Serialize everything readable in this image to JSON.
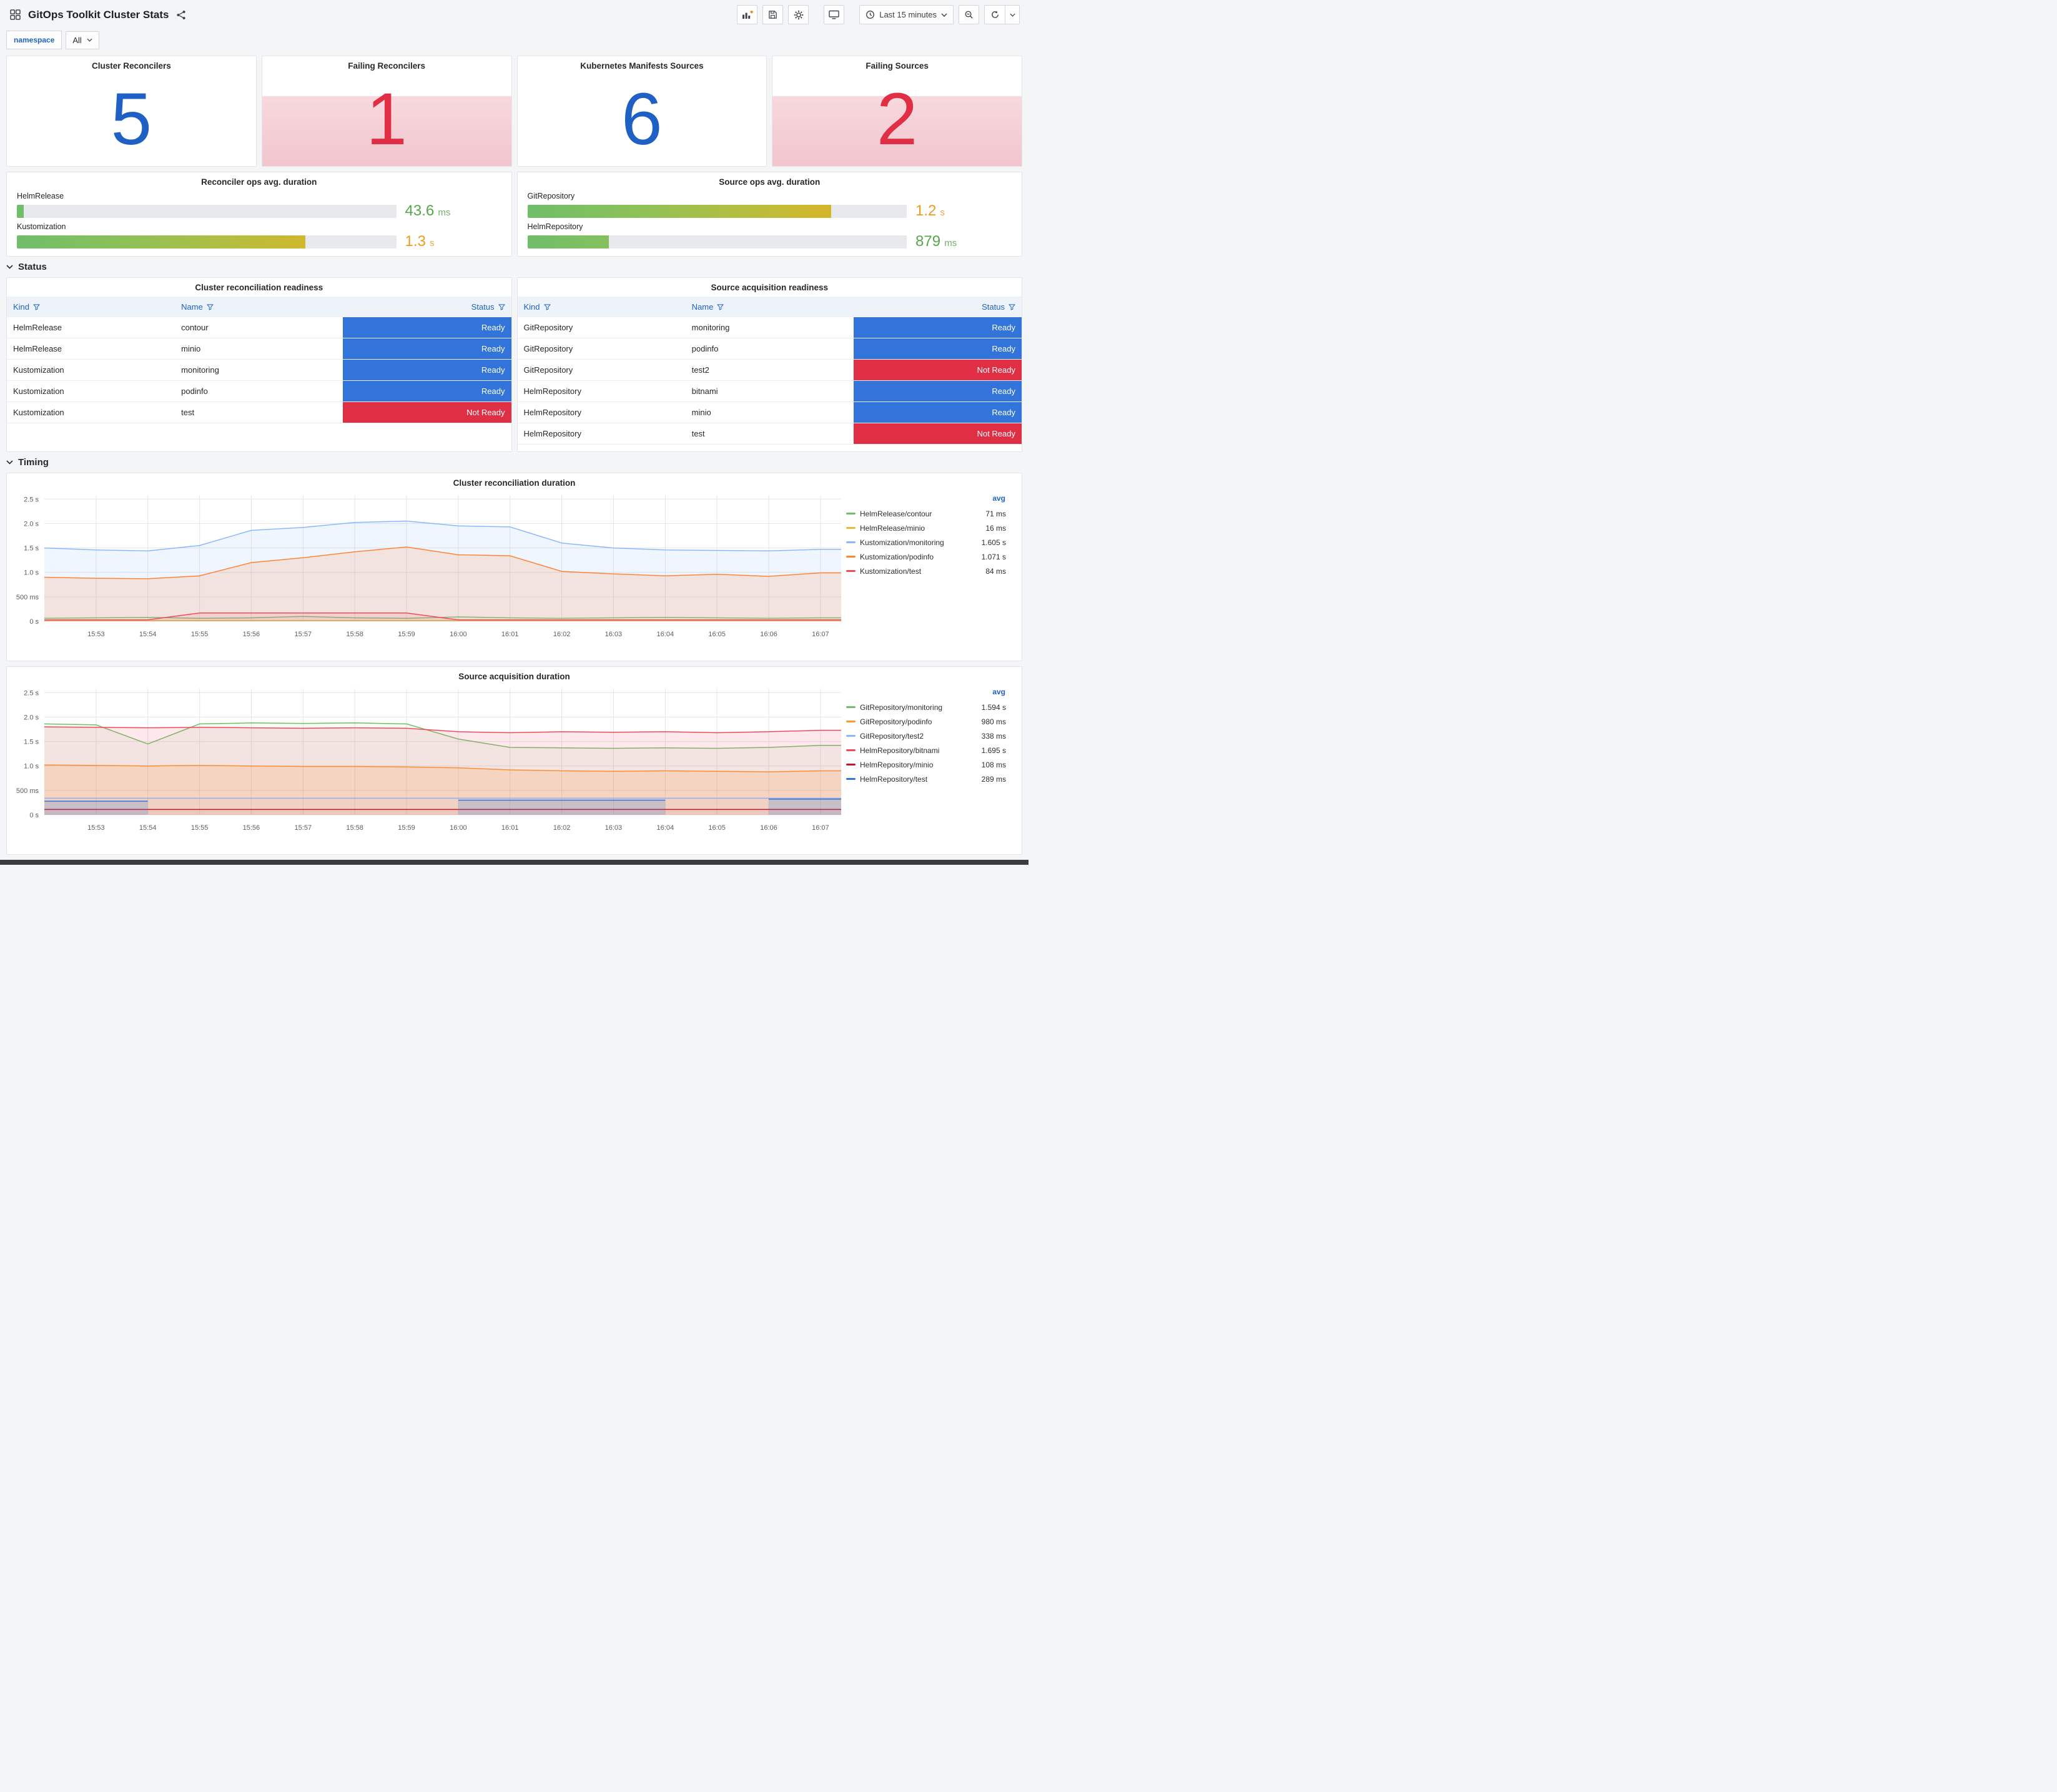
{
  "header": {
    "title": "GitOps Toolkit Cluster Stats",
    "time_picker": "Last 15 minutes"
  },
  "variables": {
    "label": "namespace",
    "value": "All"
  },
  "colors": {
    "ok": "#1f60c4",
    "alert": "#e02f44",
    "ready": "#3274d9",
    "not_ready": "#e02f44",
    "accent": "#1f62c4"
  },
  "icons": [
    "apps-grid-icon",
    "share-icon",
    "panel-add-icon",
    "save-icon",
    "gear-icon",
    "tv-icon",
    "clock-icon",
    "zoom-out-icon",
    "refresh-icon",
    "caret-down-icon",
    "chevron-down-icon",
    "filter-icon"
  ],
  "stats": [
    {
      "title": "Cluster Reconcilers",
      "value": "5",
      "state": "ok"
    },
    {
      "title": "Failing Reconcilers",
      "value": "1",
      "state": "alert"
    },
    {
      "title": "Kubernetes Manifests Sources",
      "value": "6",
      "state": "ok"
    },
    {
      "title": "Failing Sources",
      "value": "2",
      "state": "alert"
    }
  ],
  "gauges": [
    {
      "title": "Reconciler ops avg. duration",
      "bars": [
        {
          "label": "HelmRelease",
          "value": "43.6",
          "unit": "ms",
          "percent": 1.8,
          "value_color": "#56a64b"
        },
        {
          "label": "Kustomization",
          "value": "1.3",
          "unit": "s",
          "percent": 76,
          "value_color": "#ef9b20"
        }
      ]
    },
    {
      "title": "Source ops avg. duration",
      "bars": [
        {
          "label": "GitRepository",
          "value": "1.2",
          "unit": "s",
          "percent": 80,
          "value_color": "#ef9b20"
        },
        {
          "label": "HelmRepository",
          "value": "879",
          "unit": "ms",
          "percent": 21.5,
          "value_color": "#56a64b"
        }
      ]
    }
  ],
  "sections": {
    "status": "Status",
    "timing": "Timing"
  },
  "status_tables": [
    {
      "title": "Cluster reconciliation readiness",
      "columns": [
        "Kind",
        "Name",
        "Status"
      ],
      "rows": [
        {
          "kind": "HelmRelease",
          "name": "contour",
          "status": "Ready"
        },
        {
          "kind": "HelmRelease",
          "name": "minio",
          "status": "Ready"
        },
        {
          "kind": "Kustomization",
          "name": "monitoring",
          "status": "Ready"
        },
        {
          "kind": "Kustomization",
          "name": "podinfo",
          "status": "Ready"
        },
        {
          "kind": "Kustomization",
          "name": "test",
          "status": "Not Ready"
        }
      ]
    },
    {
      "title": "Source acquisition readiness",
      "columns": [
        "Kind",
        "Name",
        "Status"
      ],
      "rows": [
        {
          "kind": "GitRepository",
          "name": "monitoring",
          "status": "Ready"
        },
        {
          "kind": "GitRepository",
          "name": "podinfo",
          "status": "Ready"
        },
        {
          "kind": "GitRepository",
          "name": "test2",
          "status": "Not Ready"
        },
        {
          "kind": "HelmRepository",
          "name": "bitnami",
          "status": "Ready"
        },
        {
          "kind": "HelmRepository",
          "name": "minio",
          "status": "Ready"
        },
        {
          "kind": "HelmRepository",
          "name": "test",
          "status": "Not Ready"
        }
      ]
    }
  ],
  "chart_data": [
    {
      "type": "line",
      "title": "Cluster reconciliation duration",
      "legend_value_header": "avg",
      "legend_position": "right",
      "grid": true,
      "xlim": [
        0,
        15.4
      ],
      "ylim": [
        0,
        2.58
      ],
      "y_ticks": [
        0,
        0.5,
        1.0,
        1.5,
        2.0,
        2.5
      ],
      "y_tick_labels": [
        "0 s",
        "500 ms",
        "1.0 s",
        "1.5 s",
        "2.0 s",
        "2.5 s"
      ],
      "x_ticks": [
        1,
        2,
        3,
        4,
        5,
        6,
        7,
        8,
        9,
        10,
        11,
        12,
        13,
        14,
        15
      ],
      "x_tick_labels": [
        "15:53",
        "15:54",
        "15:55",
        "15:56",
        "15:57",
        "15:58",
        "15:59",
        "16:00",
        "16:01",
        "16:02",
        "16:03",
        "16:04",
        "16:05",
        "16:06",
        "16:07"
      ],
      "x": [
        0,
        1,
        2,
        3,
        4,
        5,
        6,
        7,
        8,
        9,
        10,
        11,
        12,
        13,
        14,
        15,
        15.4
      ],
      "series": [
        {
          "name": "HelmRelease/contour",
          "avg": "71 ms",
          "color": "#73bf69",
          "fill": 0.08,
          "values": [
            0.06,
            0.07,
            0.08,
            0.06,
            0.07,
            0.1,
            0.07,
            0.06,
            0.09,
            0.07,
            0.06,
            0.07,
            0.08,
            0.07,
            0.06,
            0.07,
            0.07
          ]
        },
        {
          "name": "HelmRelease/minio",
          "avg": "16 ms",
          "color": "#eab839",
          "fill": 0.06,
          "values": [
            0.016,
            0.016,
            0.016,
            0.016,
            0.016,
            0.016,
            0.016,
            0.016,
            0.016,
            0.016,
            0.016,
            0.016,
            0.016,
            0.016,
            0.016,
            0.016,
            0.016
          ]
        },
        {
          "name": "Kustomization/monitoring",
          "avg": "1.605 s",
          "color": "#8ab8ff",
          "fill": 0.13,
          "values": [
            1.5,
            1.46,
            1.44,
            1.55,
            1.86,
            1.92,
            2.02,
            2.05,
            1.95,
            1.93,
            1.6,
            1.5,
            1.46,
            1.45,
            1.44,
            1.47,
            1.47
          ]
        },
        {
          "name": "Kustomization/podinfo",
          "avg": "1.071 s",
          "color": "#ff8438",
          "fill": 0.16,
          "values": [
            0.9,
            0.88,
            0.87,
            0.93,
            1.2,
            1.3,
            1.42,
            1.52,
            1.36,
            1.34,
            1.02,
            0.97,
            0.93,
            0.96,
            0.92,
            0.99,
            0.99
          ]
        },
        {
          "name": "Kustomization/test",
          "avg": "84 ms",
          "color": "#f2495c",
          "fill": 0.1,
          "values": [
            0.03,
            0.03,
            0.03,
            0.17,
            0.17,
            0.17,
            0.17,
            0.17,
            0.03,
            0.03,
            0.03,
            0.03,
            0.03,
            0.03,
            0.03,
            0.03,
            0.03
          ]
        }
      ]
    },
    {
      "type": "line",
      "title": "Source acquisition duration",
      "legend_value_header": "avg",
      "legend_position": "right",
      "grid": true,
      "xlim": [
        0,
        15.4
      ],
      "ylim": [
        0,
        2.58
      ],
      "y_ticks": [
        0,
        0.5,
        1.0,
        1.5,
        2.0,
        2.5
      ],
      "y_tick_labels": [
        "0 s",
        "500 ms",
        "1.0 s",
        "1.5 s",
        "2.0 s",
        "2.5 s"
      ],
      "x_ticks": [
        1,
        2,
        3,
        4,
        5,
        6,
        7,
        8,
        9,
        10,
        11,
        12,
        13,
        14,
        15
      ],
      "x_tick_labels": [
        "15:53",
        "15:54",
        "15:55",
        "15:56",
        "15:57",
        "15:58",
        "15:59",
        "16:00",
        "16:01",
        "16:02",
        "16:03",
        "16:04",
        "16:05",
        "16:06",
        "16:07"
      ],
      "x": [
        0,
        1,
        2,
        3,
        4,
        5,
        6,
        7,
        8,
        9,
        10,
        11,
        12,
        13,
        14,
        15,
        15.4
      ],
      "series": [
        {
          "name": "GitRepository/monitoring",
          "avg": "1.594 s",
          "color": "#73bf69",
          "fill": 0.07,
          "values": [
            1.86,
            1.84,
            1.45,
            1.86,
            1.88,
            1.87,
            1.88,
            1.86,
            1.55,
            1.38,
            1.37,
            1.36,
            1.37,
            1.36,
            1.38,
            1.42,
            1.42
          ]
        },
        {
          "name": "GitRepository/podinfo",
          "avg": "980 ms",
          "color": "#ff9830",
          "fill": 0.18,
          "values": [
            1.02,
            1.01,
            1.0,
            1.01,
            1.0,
            0.99,
            0.99,
            0.98,
            0.96,
            0.92,
            0.9,
            0.89,
            0.9,
            0.89,
            0.88,
            0.9,
            0.9
          ]
        },
        {
          "name": "GitRepository/test2",
          "avg": "338 ms",
          "color": "#8ab8ff",
          "fill": 0.06,
          "values": [
            0.34,
            0.34,
            0.34,
            0.34,
            0.34,
            0.34,
            0.34,
            0.34,
            0.34,
            0.34,
            0.34,
            0.34,
            0.34,
            0.34,
            0.34,
            0.34,
            0.34
          ]
        },
        {
          "name": "HelmRepository/bitnami",
          "avg": "1.695 s",
          "color": "#f2495c",
          "fill": 0.12,
          "values": [
            1.8,
            1.79,
            1.78,
            1.79,
            1.78,
            1.77,
            1.78,
            1.77,
            1.7,
            1.68,
            1.7,
            1.69,
            1.7,
            1.68,
            1.7,
            1.73,
            1.73
          ]
        },
        {
          "name": "HelmRepository/minio",
          "avg": "108 ms",
          "color": "#c4162a",
          "fill": 0.05,
          "values": [
            0.11,
            0.11,
            0.11,
            0.11,
            0.11,
            0.11,
            0.11,
            0.11,
            0.11,
            0.11,
            0.11,
            0.11,
            0.11,
            0.11,
            0.11,
            0.11,
            0.11
          ]
        },
        {
          "name": "HelmRepository/test",
          "avg": "289 ms",
          "color": "#3274d9",
          "fill": 0.2,
          "values": [
            0.28,
            0.28,
            0.28,
            null,
            null,
            null,
            null,
            null,
            0.3,
            0.3,
            0.3,
            0.3,
            0.3,
            null,
            0.32,
            0.32,
            0.32
          ]
        }
      ]
    }
  ]
}
